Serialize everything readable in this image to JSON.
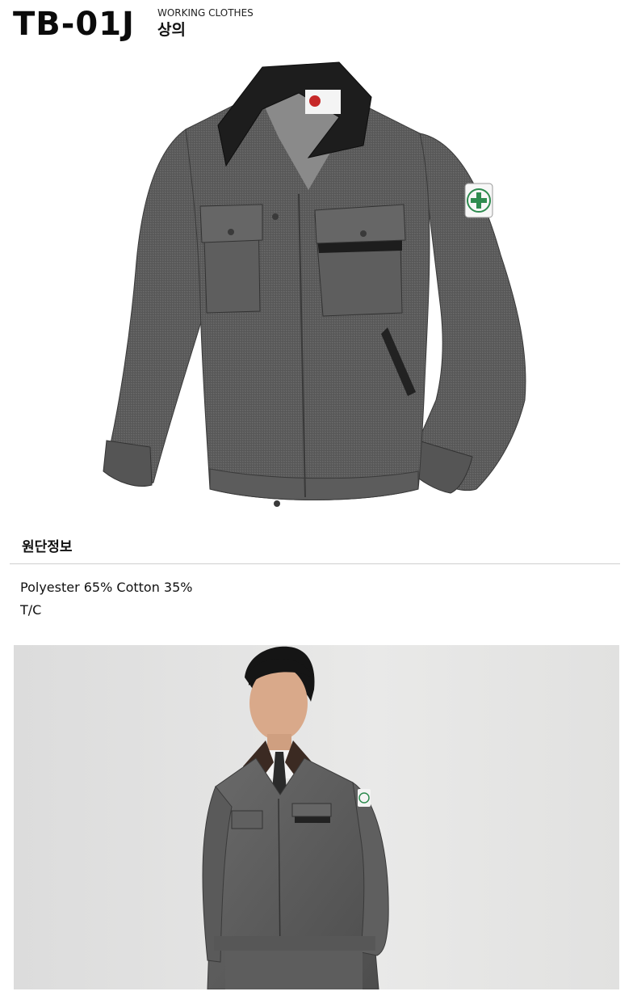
{
  "header": {
    "model_code": "TB-01J",
    "category_en": "WORKING CLOTHES",
    "category_ko": "상의"
  },
  "fabric": {
    "title": "원단정보",
    "lines": [
      "Polyester 65% Cotton 35%",
      "T/C"
    ]
  },
  "colors": {
    "jacket": "#5f5f5f",
    "jacket_dark": "#3e3e3e",
    "collar": "#1d1d1d",
    "patch_green": "#2e8b4f",
    "photo_bg": "#e6e6e4"
  },
  "images": {
    "product": "gray-work-jacket",
    "model": "man-wearing-work-jacket"
  }
}
